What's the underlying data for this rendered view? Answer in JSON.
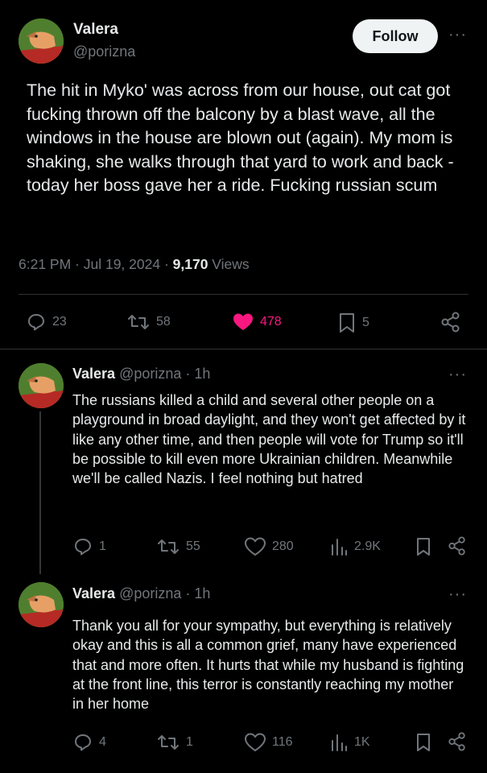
{
  "main_tweet": {
    "author_name": "Valera",
    "handle": "@porizna",
    "follow_label": "Follow",
    "more_label": "···",
    "text": "The hit in Myko' was across from our house, out cat got fucking thrown off the balcony by a blast wave, all the windows in the house are blown out (again). My mom is shaking, she walks through that yard to work and back - today her boss gave her a ride. Fucking russian scum",
    "timestamp": "6:21 PM · Jul 19, 2024 · ",
    "views_count": "9,170",
    "views_label": " Views",
    "replies": "23",
    "reposts": "58",
    "likes": "478",
    "bookmarks": "5",
    "like_color": "#f91880"
  },
  "replies": [
    {
      "author_name": "Valera",
      "handle": "@porizna",
      "time": " · 1h",
      "more_label": "···",
      "text": "The russians killed a child and several other people on a playground in broad daylight, and they won't get affected by it like any other time, and then people will vote for Trump so it'll be possible to kill even more Ukrainian children. Meanwhile we'll be called Nazis. I feel nothing but hatred",
      "replies": "1",
      "reposts": "55",
      "likes": "280",
      "views": "2.9K"
    },
    {
      "author_name": "Valera",
      "handle": "@porizna",
      "time": " · 1h",
      "more_label": "···",
      "text": "Thank you all for your sympathy, but everything is relatively okay and this is all a common grief, many have experienced that and more often. It hurts that while my husband is fighting at the front line, this terror is constantly reaching my mother in her home",
      "replies": "4",
      "reposts": "1",
      "likes": "116",
      "views": "1K"
    }
  ],
  "colors": {
    "background": "#000000",
    "text": "#e7e9ea",
    "muted": "#71767b",
    "divider": "#2f3336",
    "like": "#f91880"
  },
  "icons": [
    "avatar",
    "more-icon",
    "reply-icon",
    "repost-icon",
    "like-icon",
    "views-icon",
    "bookmark-icon",
    "share-icon"
  ]
}
